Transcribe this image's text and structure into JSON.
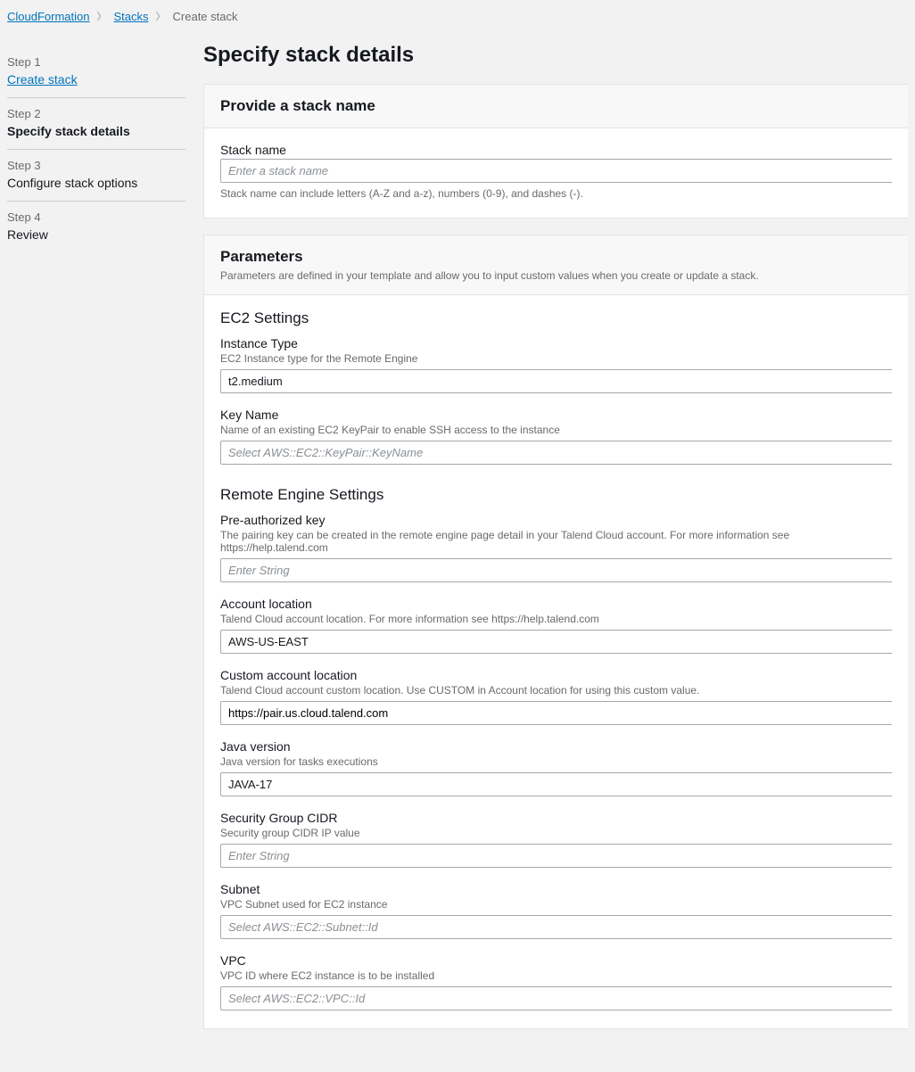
{
  "breadcrumb": {
    "items": [
      "CloudFormation",
      "Stacks"
    ],
    "current": "Create stack"
  },
  "steps": [
    {
      "num": "Step 1",
      "label": "Create stack",
      "link": true
    },
    {
      "num": "Step 2",
      "label": "Specify stack details",
      "active": true
    },
    {
      "num": "Step 3",
      "label": "Configure stack options"
    },
    {
      "num": "Step 4",
      "label": "Review"
    }
  ],
  "title": "Specify stack details",
  "stack_panel": {
    "heading": "Provide a stack name",
    "fields": {
      "name": {
        "label": "Stack name",
        "placeholder": "Enter a stack name",
        "hint": "Stack name can include letters (A-Z and a-z), numbers (0-9), and dashes (-)."
      }
    }
  },
  "params_panel": {
    "heading": "Parameters",
    "sub": "Parameters are defined in your template and allow you to input custom values when you create or update a stack.",
    "sections": {
      "ec2": {
        "title": "EC2 Settings",
        "instance_type": {
          "label": "Instance Type",
          "desc": "EC2 Instance type for the Remote Engine",
          "value": "t2.medium"
        },
        "key_name": {
          "label": "Key Name",
          "desc": "Name of an existing EC2 KeyPair to enable SSH access to the instance",
          "placeholder": "Select AWS::EC2::KeyPair::KeyName"
        }
      },
      "remote": {
        "title": "Remote Engine Settings",
        "pre_auth": {
          "label": "Pre-authorized key",
          "desc": "The pairing key can be created in the remote engine page detail in your Talend Cloud account. For more information see https://help.talend.com",
          "placeholder": "Enter String"
        },
        "account_loc": {
          "label": "Account location",
          "desc": "Talend Cloud account location. For more information see https://help.talend.com",
          "value": "AWS-US-EAST"
        },
        "custom_loc": {
          "label": "Custom account location",
          "desc": "Talend Cloud account custom location. Use CUSTOM in Account location for using this custom value.",
          "value": "https://pair.us.cloud.talend.com"
        },
        "java": {
          "label": "Java version",
          "desc": "Java version for tasks executions",
          "value": "JAVA-17"
        },
        "sec_cidr": {
          "label": "Security Group CIDR",
          "desc": "Security group CIDR IP value",
          "placeholder": "Enter String"
        },
        "subnet": {
          "label": "Subnet",
          "desc": "VPC Subnet used for EC2 instance",
          "placeholder": "Select AWS::EC2::Subnet::Id"
        },
        "vpc": {
          "label": "VPC",
          "desc": "VPC ID where EC2 instance is to be installed",
          "placeholder": "Select AWS::EC2::VPC::Id"
        }
      }
    }
  }
}
